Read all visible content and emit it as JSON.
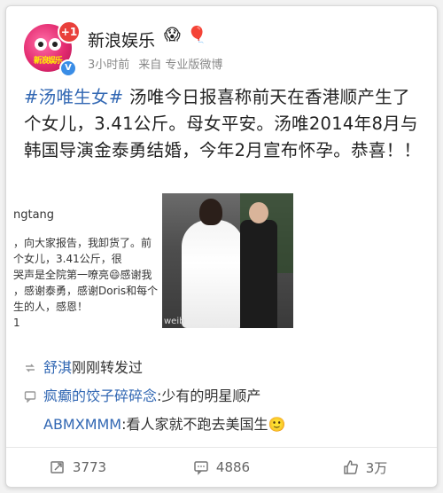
{
  "user": {
    "name": "新浪娱乐",
    "avatar_text": "新浪娱乐",
    "badge": "+1",
    "verified": "V",
    "emojis": [
      "😱",
      "🎈"
    ]
  },
  "meta": {
    "time": "3小时前",
    "source": "来自 专业版微博"
  },
  "post": {
    "hashtag": "#汤唯生女#",
    "body": " 汤唯今日报喜称前天在香港顺产生了个女儿，3.41公斤。母女平安。汤唯2014年8月与韩国导演金泰勇结婚，今年2月宣布怀孕。恭喜！！"
  },
  "repost_image": {
    "account": "ngtang",
    "lines": [
      "，向大家报告，我卸货了。前",
      "个女儿，3.41公斤，很",
      "哭声是全院第一嘹亮😄感谢我",
      "，感谢泰勇，感谢Doris和每个",
      "生的人，感恩！"
    ],
    "extra_char": "1"
  },
  "photo": {
    "watermark": "weib"
  },
  "repost": {
    "name": "舒淇",
    "text": "刚刚转发过"
  },
  "comments": [
    {
      "name": "疯癫的饺子碎碎念",
      "text": ":少有的明星顺产"
    },
    {
      "name": "ABMXMMM",
      "text": ":看人家就不跑去美国生🙂"
    }
  ],
  "actions": {
    "repost_count": "3773",
    "comment_count": "4886",
    "like_count": "3万"
  },
  "colors": {
    "link": "#3167b3",
    "background": "#f2f2f2"
  }
}
